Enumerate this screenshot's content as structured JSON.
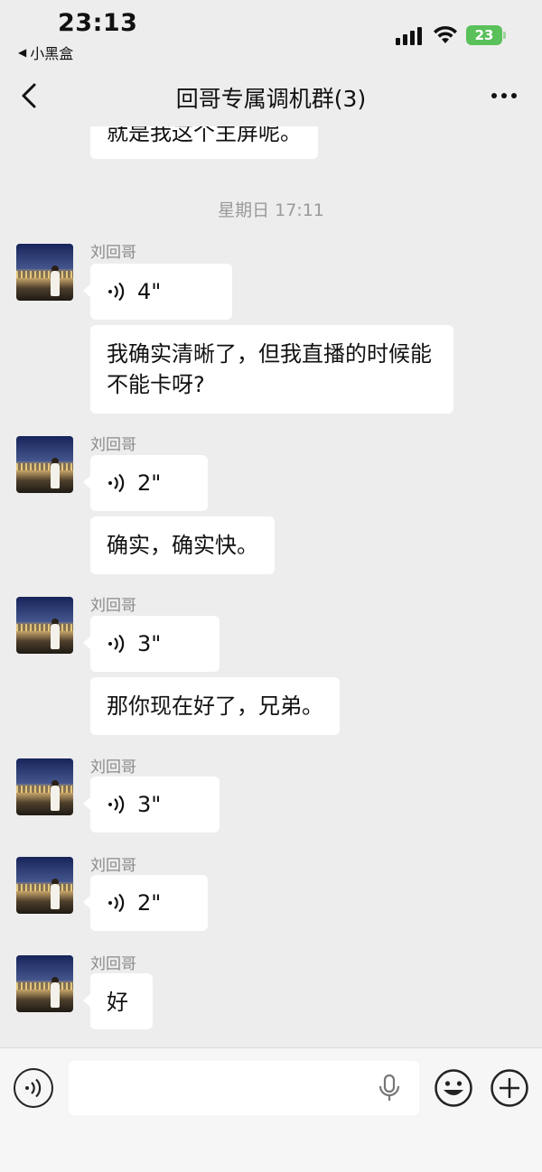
{
  "status_bar": {
    "time": "23:13",
    "back_app": "小黑盒",
    "battery": "23"
  },
  "nav": {
    "title": "回哥专属调机群(3)"
  },
  "chat": {
    "partial_message": "就是我这个主屏呢。",
    "timestamp": "星期日 17:11",
    "groups": [
      {
        "sender": "刘回哥",
        "voice_duration": "4\"",
        "text": "我确实清晰了，但我直播的时候能不能卡呀?"
      },
      {
        "sender": "刘回哥",
        "voice_duration": "2\"",
        "text": "确实，确实快。"
      },
      {
        "sender": "刘回哥",
        "voice_duration": "3\"",
        "text": "那你现在好了，兄弟。"
      },
      {
        "sender": "刘回哥",
        "voice_duration": "3\""
      },
      {
        "sender": "刘回哥",
        "voice_duration": "2\""
      },
      {
        "sender": "刘回哥",
        "text": "好"
      }
    ]
  },
  "icons": {
    "voice_toggle": "voice-toggle-icon",
    "mic": "microphone-icon",
    "emoji": "emoji-icon",
    "plus": "plus-icon",
    "back": "chevron-left-icon",
    "more": "more-dots-icon"
  },
  "colors": {
    "background": "#ededed",
    "bubble": "#ffffff",
    "battery": "#5ac05a",
    "timestamp": "#9a9a9a"
  }
}
